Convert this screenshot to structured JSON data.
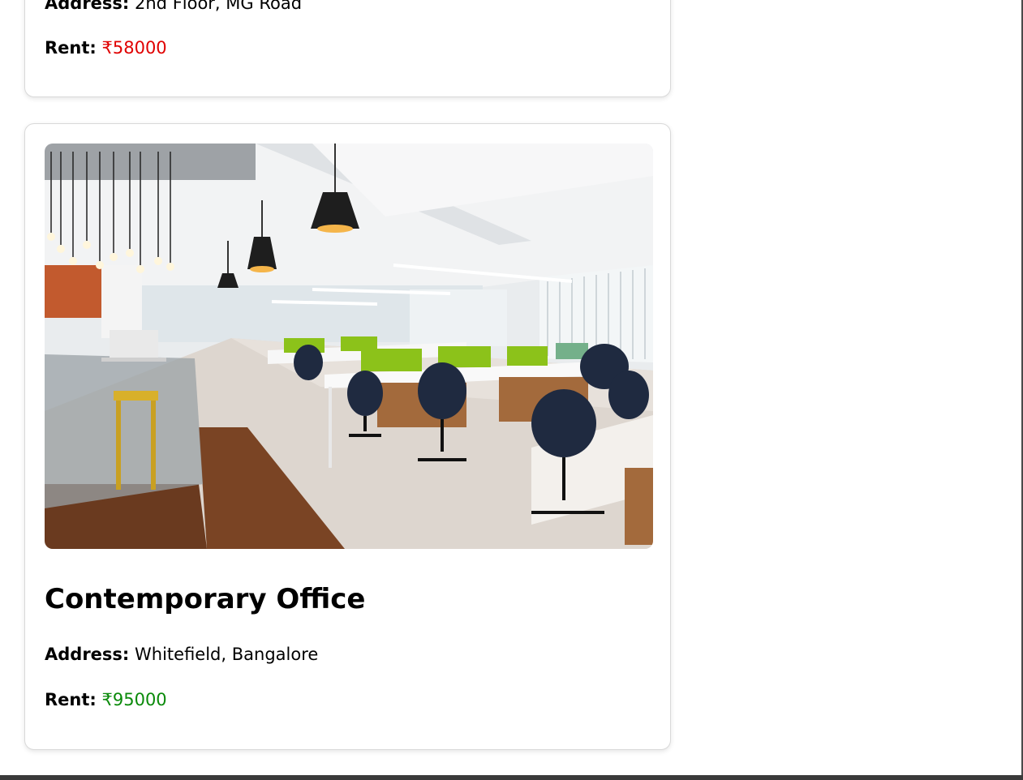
{
  "listings": [
    {
      "address_label": "Address:",
      "address": "2nd Floor, MG Road",
      "rent_label": "Rent:",
      "rent": "₹58000",
      "rent_color": "#e00000"
    },
    {
      "image_alt": "Contemporary Office",
      "title": "Contemporary Office",
      "address_label": "Address:",
      "address": "Whitefield, Bangalore",
      "rent_label": "Rent:",
      "rent": "₹95000",
      "rent_color": "#0a8a0a"
    }
  ]
}
